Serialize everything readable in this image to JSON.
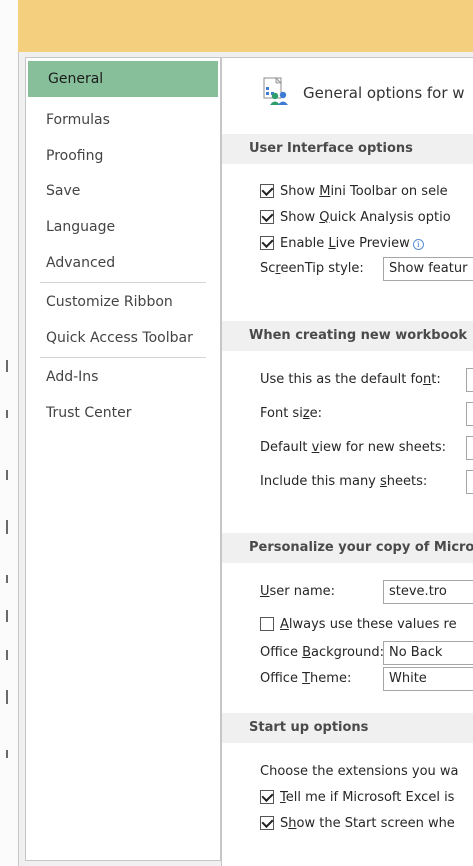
{
  "nav": {
    "items": [
      {
        "label": "General",
        "selected": true
      },
      {
        "label": "Formulas"
      },
      {
        "label": "Proofing"
      },
      {
        "label": "Save"
      },
      {
        "label": "Language"
      },
      {
        "label": "Advanced"
      },
      {
        "label": "Customize Ribbon"
      },
      {
        "label": "Quick Access Toolbar"
      },
      {
        "label": "Add-Ins"
      },
      {
        "label": "Trust Center"
      }
    ]
  },
  "header": {
    "title": "General options for w"
  },
  "ui_options": {
    "title": "User Interface options",
    "mini_toolbar": {
      "pre": "Show ",
      "key": "M",
      "post": "ini Toolbar on sele",
      "checked": true
    },
    "quick_analysis": {
      "pre": "Show ",
      "key": "Q",
      "post": "uick Analysis optio",
      "checked": true
    },
    "live_preview": {
      "pre": "Enable ",
      "key": "L",
      "post": "ive Preview",
      "checked": true
    },
    "screentip": {
      "pre": "Sc",
      "key": "r",
      "post": "eenTip style:",
      "value": "Show featur"
    }
  },
  "new_workbook": {
    "title": "When creating new workbook",
    "default_font": {
      "pre": "Use this as the default fo",
      "key": "n",
      "post": "t:"
    },
    "font_size": {
      "pre": "Font si",
      "key": "z",
      "post": "e:"
    },
    "default_view": {
      "pre": "Default ",
      "key": "v",
      "post": "iew for new sheets:"
    },
    "sheets": {
      "pre": "Include this many ",
      "key": "s",
      "post": "heets:"
    }
  },
  "personalize": {
    "title": "Personalize your copy of Micro",
    "user_name": {
      "pre": "",
      "key": "U",
      "post": "ser name:",
      "value": "steve.tro"
    },
    "always_use": {
      "pre": "",
      "key": "A",
      "post": "lways use these values re",
      "checked": false
    },
    "background": {
      "pre": "Office ",
      "key": "B",
      "post": "ackground:",
      "value": "No Back"
    },
    "theme": {
      "pre": "Office ",
      "key": "T",
      "post": "heme:",
      "value": "White"
    }
  },
  "startup": {
    "title": "Start up options",
    "extensions_text": "Choose the extensions you wa",
    "tell_me": {
      "pre": "",
      "key": "T",
      "post": "ell me if Microsoft Excel is",
      "checked": true
    },
    "start_screen": {
      "pre": "S",
      "key": "h",
      "post": "ow the Start screen whe",
      "checked": true
    }
  },
  "colors": {
    "accent": "#86bf9a",
    "titlebar": "#f4cf7e",
    "info": "#3d7bd5"
  }
}
